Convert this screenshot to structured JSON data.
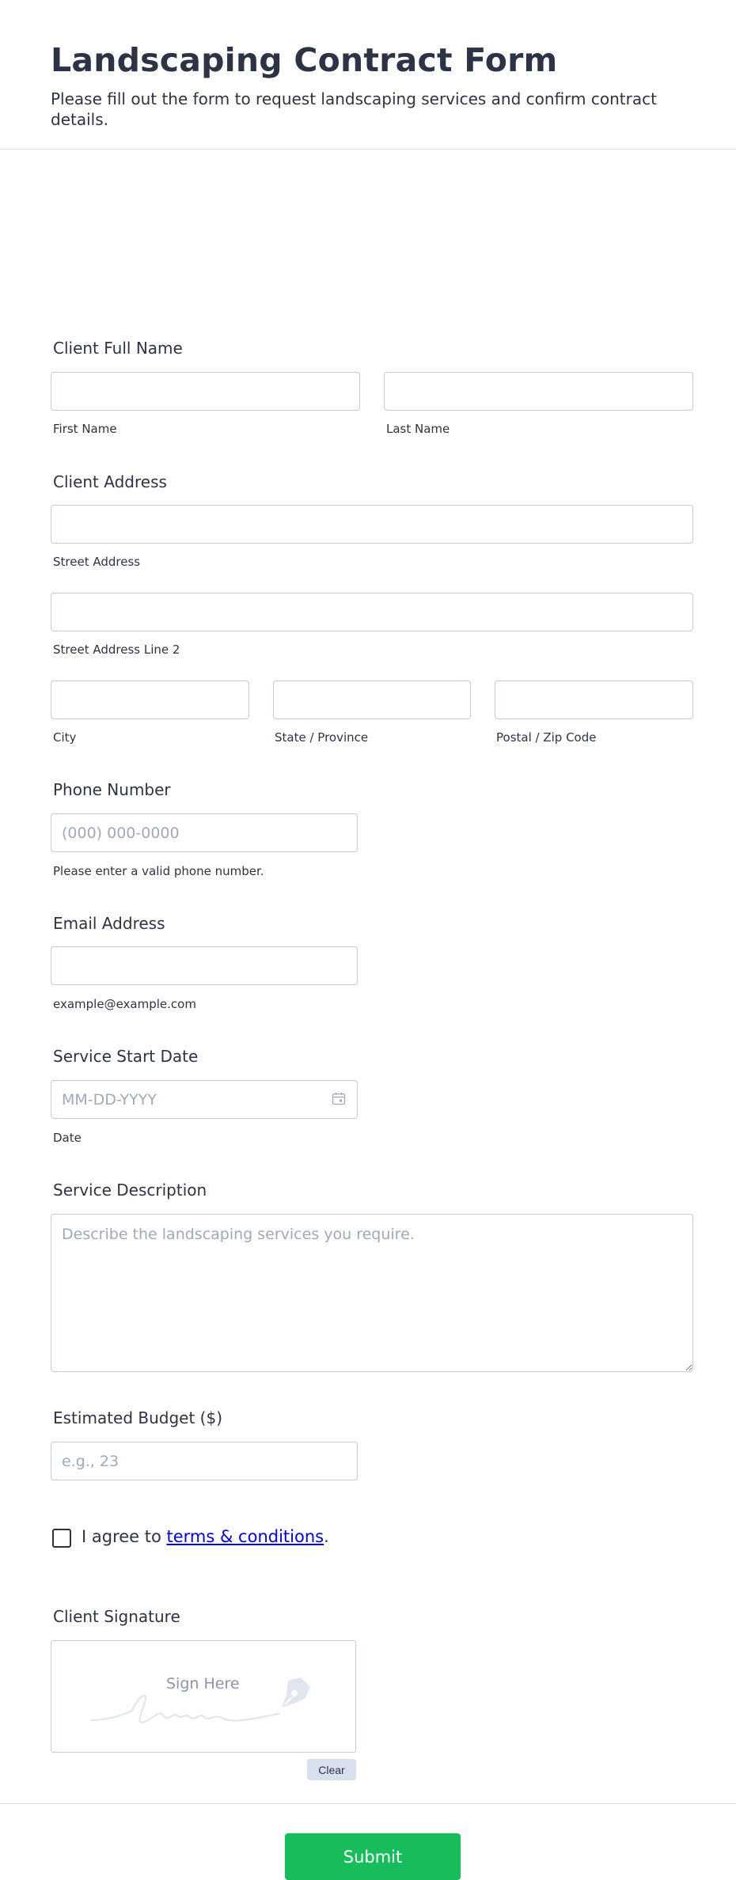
{
  "header": {
    "title": "Landscaping Contract Form",
    "subtitle": "Please fill out the form to request landscaping services and confirm contract details."
  },
  "client_name": {
    "label": "Client Full Name",
    "first_sub": "First Name",
    "last_sub": "Last Name"
  },
  "client_address": {
    "label": "Client Address",
    "street_sub": "Street Address",
    "street2_sub": "Street Address Line 2",
    "city_sub": "City",
    "state_sub": "State / Province",
    "zip_sub": "Postal / Zip Code"
  },
  "phone": {
    "label": "Phone Number",
    "placeholder": "(000) 000-0000",
    "sub": "Please enter a valid phone number."
  },
  "email": {
    "label": "Email Address",
    "sub": "example@example.com"
  },
  "start_date": {
    "label": "Service Start Date",
    "placeholder": "MM-DD-YYYY",
    "sub": "Date",
    "icon": "calendar-icon"
  },
  "description": {
    "label": "Service Description",
    "placeholder": "Describe the landscaping services you require."
  },
  "budget": {
    "label": "Estimated Budget ($)",
    "placeholder": "e.g., 23"
  },
  "terms": {
    "prefix": "I agree to ",
    "link": "terms & conditions",
    "suffix": "."
  },
  "signature": {
    "label": "Client Signature",
    "placeholder": "Sign Here",
    "clear": "Clear",
    "icon": "pen-icon"
  },
  "submit": "Submit",
  "colors": {
    "accent": "#18bd5b",
    "text": "#2c3345",
    "border": "#c3cad8",
    "placeholder": "#a0a8bb"
  }
}
